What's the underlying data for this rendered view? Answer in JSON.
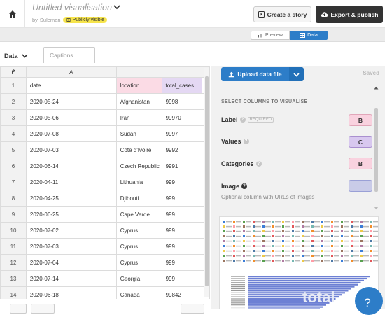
{
  "header": {
    "title": "Untitled visualisation",
    "author_prefix": "by",
    "author": "Suleman",
    "visibility": "Publicly visible",
    "create_story": "Create a story",
    "export_publish": "Export & publish"
  },
  "view_toggle": {
    "preview": "Preview",
    "data": "Data",
    "active": "Data"
  },
  "sheet_tabs": {
    "data": "Data",
    "captions": "Captions"
  },
  "sheet": {
    "corner": "↱",
    "column_letters": [
      "A",
      "",
      "",
      ""
    ],
    "column_letters_labeled": {
      "A": "A"
    },
    "rows": [
      {
        "n": "1",
        "a": "date",
        "b": "location",
        "c": "total_cases"
      },
      {
        "n": "2",
        "a": "2020-05-24",
        "b": "Afghanistan",
        "c": "9998"
      },
      {
        "n": "3",
        "a": "2020-05-06",
        "b": "Iran",
        "c": "99970"
      },
      {
        "n": "4",
        "a": "2020-07-08",
        "b": "Sudan",
        "c": "9997"
      },
      {
        "n": "5",
        "a": "2020-07-03",
        "b": "Cote d'Ivoire",
        "c": "9992"
      },
      {
        "n": "6",
        "a": "2020-06-14",
        "b": "Czech Republic",
        "c": "9991"
      },
      {
        "n": "7",
        "a": "2020-04-11",
        "b": "Lithuania",
        "c": "999"
      },
      {
        "n": "8",
        "a": "2020-04-25",
        "b": "Djibouti",
        "c": "999"
      },
      {
        "n": "9",
        "a": "2020-06-25",
        "b": "Cape Verde",
        "c": "999"
      },
      {
        "n": "10",
        "a": "2020-07-02",
        "b": "Cyprus",
        "c": "999"
      },
      {
        "n": "11",
        "a": "2020-07-03",
        "b": "Cyprus",
        "c": "999"
      },
      {
        "n": "12",
        "a": "2020-07-04",
        "b": "Cyprus",
        "c": "999"
      },
      {
        "n": "13",
        "a": "2020-07-14",
        "b": "Georgia",
        "c": "999"
      },
      {
        "n": "14",
        "a": "2020-06-18",
        "b": "Canada",
        "c": "99842"
      }
    ]
  },
  "panel": {
    "upload": "Upload data file",
    "saved": "Saved",
    "section_title": "SELECT COLUMNS TO VISUALISE",
    "label": "Label",
    "required": "REQUIRED",
    "label_col": "B",
    "values": "Values",
    "values_col": "C",
    "categories": "Categories",
    "categories_col": "B",
    "image": "Image",
    "image_col": "",
    "image_hint": "Optional column with URLs of images"
  },
  "colors": {
    "primary": "#2d7dc8",
    "label_box": "#f9d2df",
    "values_box": "#d8c8ef",
    "categories_box": "#f9d2df",
    "image_box": "#c9cbe8",
    "dark": "#333333",
    "badge": "#f6e44b"
  },
  "thumbnail": {
    "watermark": "total"
  },
  "help": "?"
}
